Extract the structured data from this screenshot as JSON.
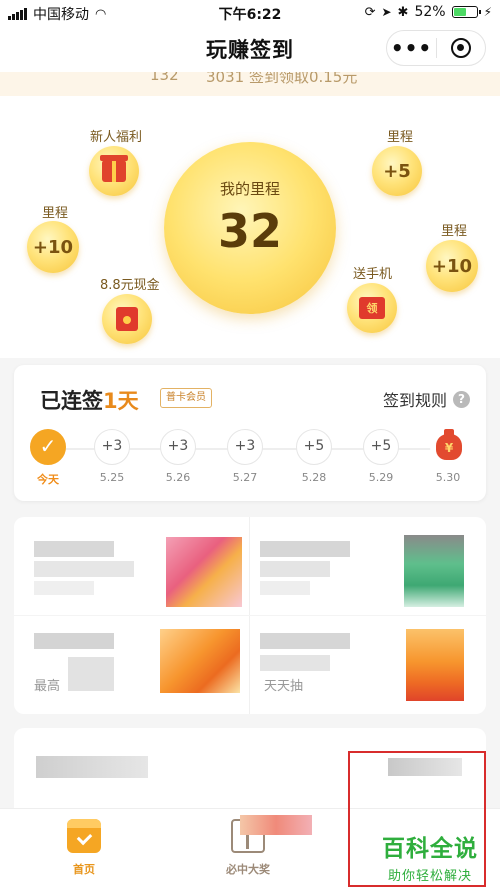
{
  "status_bar": {
    "carrier": "中国移动",
    "time": "下午6:22",
    "battery_percent": "52%"
  },
  "nav": {
    "title": "玩赚签到",
    "more_label": "•••"
  },
  "banner": {
    "left_text": "132",
    "right_text": "3031 签到领取0.15元"
  },
  "hero": {
    "main_label": "我的里程",
    "main_value": "32",
    "bubbles": [
      {
        "label": "新人福利",
        "icon": "gift-icon"
      },
      {
        "label": "里程",
        "value": "+5"
      },
      {
        "label": "里程",
        "value": "+10"
      },
      {
        "label": "8.8元现金",
        "icon": "red-envelope-icon"
      },
      {
        "label": "送手机",
        "icon": "phone-envelope-icon",
        "glyph": "领"
      },
      {
        "label": "里程",
        "value": "+10"
      }
    ]
  },
  "sign_in": {
    "streak_prefix": "已连签",
    "streak_days": "1天",
    "member_badge": "普卡会员",
    "rules_label": "签到规则",
    "help_glyph": "?",
    "days": [
      {
        "value": "✓",
        "date": "今天"
      },
      {
        "value": "+3",
        "date": "5.25"
      },
      {
        "value": "+3",
        "date": "5.26"
      },
      {
        "value": "+3",
        "date": "5.27"
      },
      {
        "value": "+5",
        "date": "5.28"
      },
      {
        "value": "+5",
        "date": "5.29"
      },
      {
        "value": "¥",
        "date": "5.30"
      }
    ]
  },
  "grid": {
    "partial_text_1": "最高",
    "partial_text_2": "天天抽"
  },
  "tabs": [
    {
      "label": "首页",
      "color": "#e8961e"
    },
    {
      "label": "必中大奖",
      "color": "#9c8a78"
    }
  ],
  "watermark": {
    "title": "百科全说",
    "subtitle": "助你轻松解决"
  },
  "colors": {
    "accent": "#f5a623",
    "coin": "#ffe37a",
    "watermark": "#2fae3d",
    "frame": "#d82c2c"
  }
}
